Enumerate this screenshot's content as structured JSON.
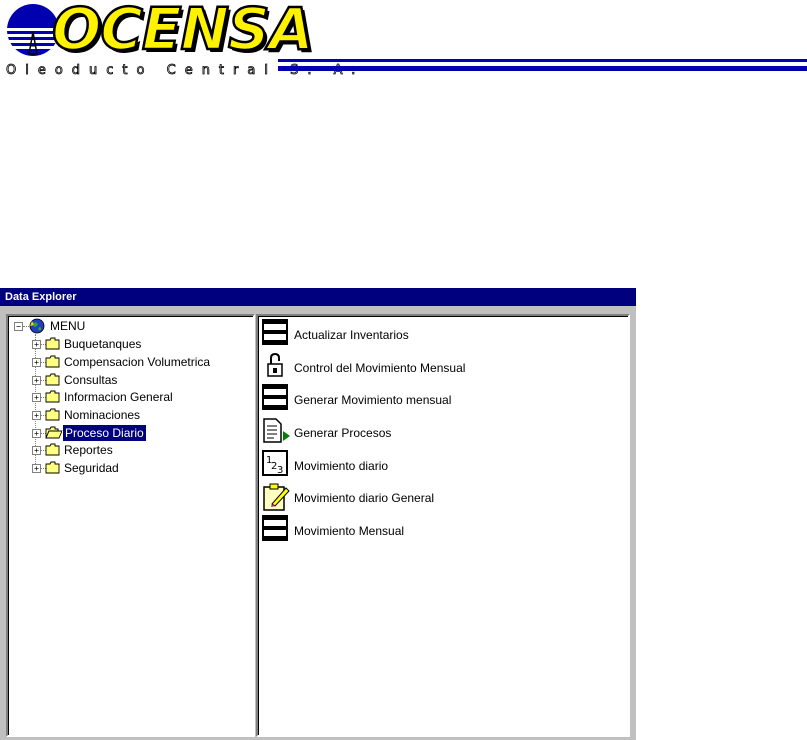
{
  "header": {
    "logo_word": "OCENSA",
    "logo_subtitle": "Oleoducto  Central  S. A."
  },
  "window": {
    "title": "Data Explorer"
  },
  "tree": {
    "root": {
      "label": "MENU",
      "icon": "globe-icon"
    },
    "items": [
      {
        "label": "Buquetanques",
        "icon": "folder-icon"
      },
      {
        "label": "Compensacion Volumetrica",
        "icon": "folder-icon"
      },
      {
        "label": "Consultas",
        "icon": "folder-icon"
      },
      {
        "label": "Informacion General",
        "icon": "folder-icon"
      },
      {
        "label": "Nominaciones",
        "icon": "folder-icon"
      },
      {
        "label": "Proceso Diario",
        "icon": "folder-open-icon",
        "selected": true
      },
      {
        "label": "Reportes",
        "icon": "folder-icon"
      },
      {
        "label": "Seguridad",
        "icon": "folder-icon"
      }
    ]
  },
  "list": {
    "items": [
      {
        "label": "Actualizar Inventarios",
        "icon": "form-icon"
      },
      {
        "label": "Control del Movimiento Mensual",
        "icon": "lock-icon"
      },
      {
        "label": "Generar Movimiento mensual",
        "icon": "form-icon"
      },
      {
        "label": "Generar Procesos",
        "icon": "run-document-icon"
      },
      {
        "label": "Movimiento diario",
        "icon": "numbers-icon"
      },
      {
        "label": "Movimiento diario General",
        "icon": "clipboard-icon"
      },
      {
        "label": "Movimiento Mensual",
        "icon": "form-icon"
      }
    ]
  },
  "colors": {
    "titlebar": "#00007F",
    "logo_yellow": "#FFF200",
    "logo_blue": "#0000B0",
    "selection": "#00007F"
  }
}
